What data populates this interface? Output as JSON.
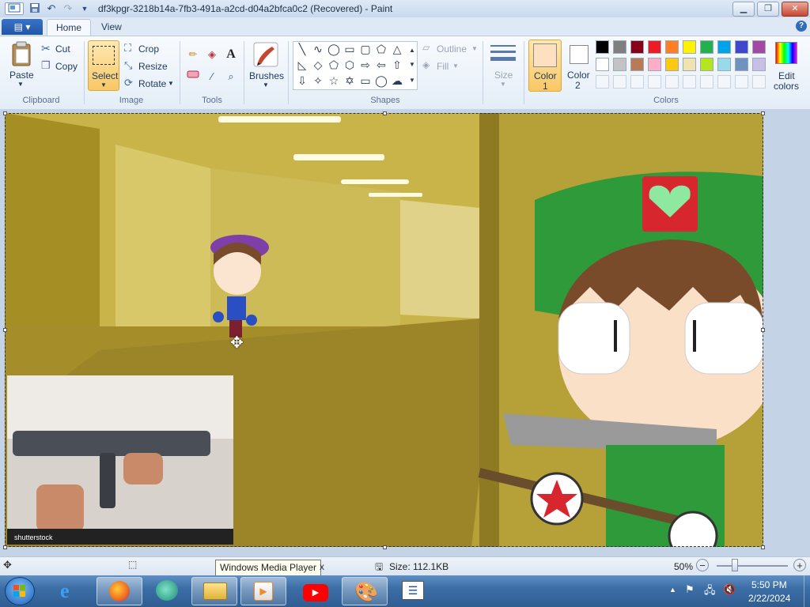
{
  "window": {
    "title": "df3kpgr-3218b14a-7fb3-491a-a2cd-d04a2bfca0c2 (Recovered) - Paint",
    "controls": [
      "minimize",
      "maximize",
      "close"
    ]
  },
  "ribbon": {
    "file_menu_icon": "menu-icon",
    "tabs": [
      {
        "label": "Home",
        "active": true
      },
      {
        "label": "View",
        "active": false
      }
    ],
    "clipboard": {
      "group": "Clipboard",
      "paste": "Paste",
      "cut": "Cut",
      "copy": "Copy"
    },
    "image": {
      "group": "Image",
      "select": "Select",
      "crop": "Crop",
      "resize": "Resize",
      "rotate": "Rotate"
    },
    "tools": {
      "group": "Tools",
      "items": [
        "pencil-icon",
        "fill-icon",
        "text-icon",
        "eraser-icon",
        "color-picker-icon",
        "magnifier-icon"
      ],
      "text_glyph": "A"
    },
    "brushes": {
      "label": "Brushes"
    },
    "shapes": {
      "group": "Shapes",
      "outline": "Outline",
      "fill": "Fill"
    },
    "size": {
      "label": "Size"
    },
    "color1": {
      "label": "Color",
      "num": "1",
      "color": "#fde0c0"
    },
    "color2": {
      "label": "Color",
      "num": "2",
      "color": "#ffffff"
    },
    "colors": {
      "group": "Colors",
      "row1": [
        "#000000",
        "#7f7f7f",
        "#880015",
        "#ed1c24",
        "#ff7f27",
        "#fff200",
        "#22b14c",
        "#00a2e8",
        "#3f48cc",
        "#a349a4"
      ],
      "row2": [
        "#ffffff",
        "#c3c3c3",
        "#b97a57",
        "#ffaec9",
        "#ffc90e",
        "#efe4b0",
        "#b5e61d",
        "#99d9ea",
        "#7092be",
        "#c8bfe7"
      ]
    },
    "edit_colors": {
      "line1": "Edit",
      "line2": "colors"
    }
  },
  "statusbar": {
    "size": "Size: 112.1KB",
    "tooltip": "Windows Media Player",
    "tooltip_tail": "x",
    "zoom": "50%"
  },
  "taskbar": {
    "apps": [
      "start-orb",
      "internet-explorer",
      "firefox",
      "media-center",
      "file-explorer",
      "windows-media-player",
      "youtube",
      "paint",
      "task-manager"
    ],
    "clock_time": "5:50 PM",
    "clock_date": "2/22/2024"
  },
  "canvas": {
    "stock_watermark": "shutterstock"
  }
}
